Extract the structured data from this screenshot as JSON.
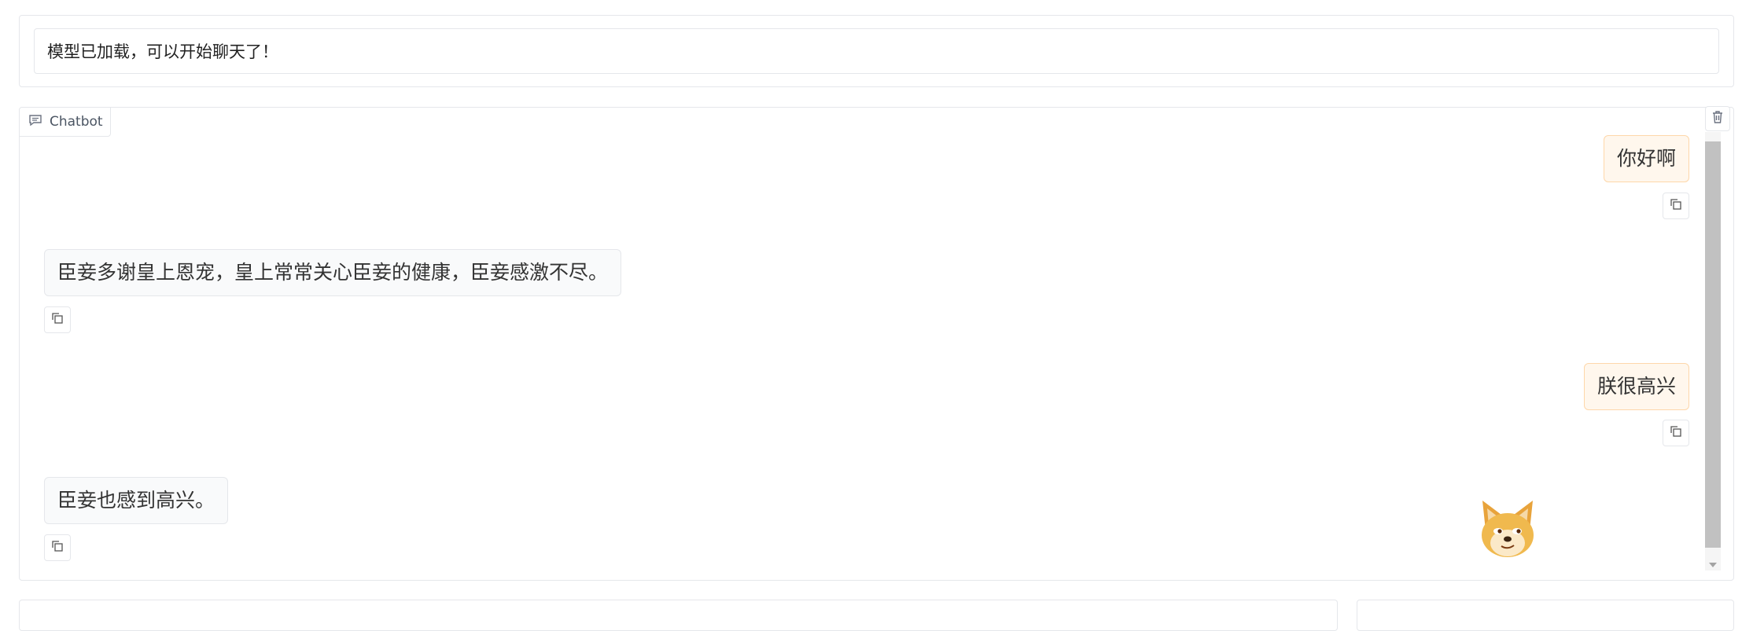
{
  "status": {
    "text": "模型已加载，可以开始聊天了！"
  },
  "chatbot": {
    "label": "Chatbot",
    "messages": [
      {
        "role": "user",
        "text": "你好啊"
      },
      {
        "role": "bot",
        "text": "臣妾多谢皇上恩宠，皇上常常关心臣妾的健康，臣妾感激不尽。"
      },
      {
        "role": "user",
        "text": "朕很高兴"
      },
      {
        "role": "bot",
        "text": "臣妾也感到高兴。"
      }
    ]
  },
  "icons": {
    "chat": "chat-bubble-icon",
    "trash": "trash-icon",
    "copy": "copy-icon",
    "avatar": "doge-emoji"
  },
  "colors": {
    "user_bubble_bg": "#fff7ed",
    "user_bubble_border": "#fed7aa",
    "bot_bubble_bg": "#f9fafb",
    "border": "#e5e7eb"
  }
}
